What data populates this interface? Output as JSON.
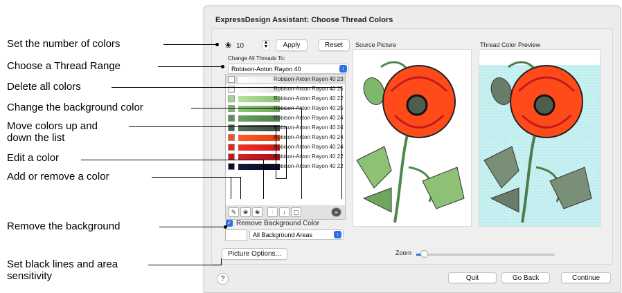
{
  "callouts": {
    "set_number": "Set the number of colors",
    "thread_range": "Choose a Thread Range",
    "delete_all": "Delete all colors",
    "change_bg": "Change the background color",
    "move_1": "Move colors up and",
    "move_2": "down the list",
    "edit": "Edit a color",
    "add_remove": "Add or remove a color",
    "remove_bg": "Remove the background",
    "black_1": "Set black lines and area",
    "black_2": "sensitivity"
  },
  "dialog": {
    "title": "ExpressDesign Assistant: Choose Thread Colors",
    "num_colors": "10",
    "apply": "Apply",
    "reset": "Reset",
    "change_all_label": "Change All Threads To:",
    "thread_range": "Robison-Anton Rayon 40",
    "threads": [
      {
        "label": "Robison-Anton Rayon 40 23",
        "color": "#ffffff"
      },
      {
        "label": "Robison-Anton Rayon 40 25",
        "color": "#f2f2f2"
      },
      {
        "label": "Robison-Anton Rayon 40 22",
        "color": "#a4d48c"
      },
      {
        "label": "Robison-Anton Rayon 40 25",
        "color": "#7fb86a"
      },
      {
        "label": "Robison-Anton Rayon 40 24",
        "color": "#5c8f5a"
      },
      {
        "label": "Robison-Anton Rayon 40 24",
        "color": "#4d5e4c"
      },
      {
        "label": "Robison-Anton Rayon 40 24",
        "color": "#ff4a1a"
      },
      {
        "label": "Robison-Anton Rayon 40 24",
        "color": "#e8231b"
      },
      {
        "label": "Robison-Anton Rayon 40 22",
        "color": "#c31a1e"
      },
      {
        "label": "Robison-Anton Rayon 40 22",
        "color": "#0b0f24"
      }
    ],
    "remove_bg_label": "Remove Background Color",
    "bg_areas": "All Background Areas",
    "picture_options": "Picture Options...",
    "source_label": "Source Picture",
    "preview_label": "Thread Color Preview",
    "zoom_label": "Zoom",
    "help": "?",
    "quit": "Quit",
    "go_back": "Go Back",
    "continue": "Continue"
  },
  "colors": {
    "accent": "#2f6fe0",
    "preview_bg": "#c9f1f2"
  }
}
